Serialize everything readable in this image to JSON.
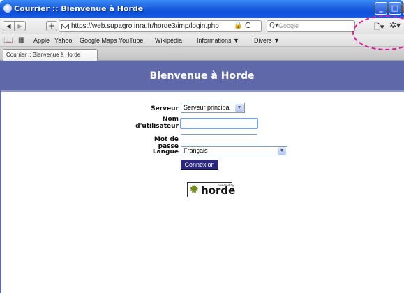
{
  "window": {
    "title": "Courrier :: Bienvenue à Horde",
    "min_label": "_",
    "max_label": "□",
    "close_label": "X"
  },
  "toolbar": {
    "back_label": "◀",
    "forward_label": "▶",
    "add_label": "+",
    "url": "https://web.supagro.inra.fr/horde3/imp/login.php",
    "lock_glyph": "🔒",
    "reload_glyph": "C",
    "search_icon": "Q▾",
    "search_placeholder": "Google",
    "page_menu": "🗋▾",
    "tools_menu": "✲▾"
  },
  "bookmarks": {
    "reader_icon": "📖",
    "grid_icon": "▦",
    "items": [
      "Apple",
      "Yahoo!",
      "Google Maps",
      "YouTube",
      "Wikipédia",
      "Informations ▼",
      "Divers ▼"
    ]
  },
  "tabs": [
    {
      "label": "Courrier :: Bienvenue à Horde"
    }
  ],
  "header": {
    "welcome": "Bienvenue à Horde"
  },
  "form": {
    "server_label": "Serveur",
    "server_value": "Serveur principal",
    "user_label_1": "Nom",
    "user_label_2": "d'utilisateur",
    "user_value": "",
    "password_label": "Mot de passe",
    "password_value": "",
    "language_label": "Langue",
    "language_value": "Français",
    "login_button": "Connexion"
  },
  "logo": {
    "powered": "powered by",
    "brand": "horde"
  },
  "colors": {
    "header_bg": "#5f69a9",
    "button_bg": "#2c2880",
    "annotation": "#e0199b"
  }
}
